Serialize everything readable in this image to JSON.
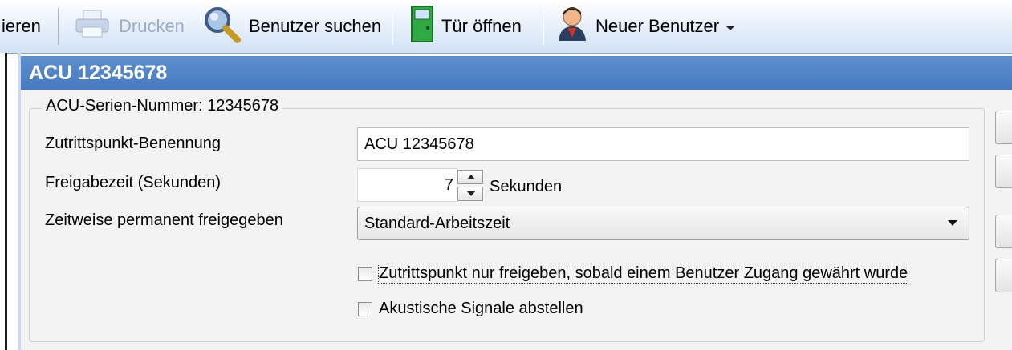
{
  "toolbar": {
    "partial_left": "ieren",
    "print": "Drucken",
    "search_user": "Benutzer suchen",
    "open_door": "Tür öffnen",
    "new_user": "Neuer Benutzer"
  },
  "header": {
    "title": "ACU 12345678"
  },
  "group": {
    "legend": "ACU-Serien-Nummer: 12345678"
  },
  "form": {
    "name_label": "Zutrittspunkt-Benennung",
    "name_value": "ACU 12345678",
    "release_label": "Freigabezeit (Sekunden)",
    "release_value": "7",
    "release_unit": "Sekunden",
    "permanent_label": "Zeitweise permanent freigegeben",
    "permanent_selected": "Standard-Arbeitszeit",
    "check_grant_label": "Zutrittspunkt nur freigeben, sobald einem Benutzer Zugang gewährt wurde",
    "check_grant_checked": false,
    "check_acoustic_label": "Akustische Signale abstellen",
    "check_acoustic_checked": false
  },
  "colors": {
    "header_bg": "#4f82c6",
    "toolbar_bg": "#dfe9f6",
    "panel_bg": "#f3f3f3"
  }
}
